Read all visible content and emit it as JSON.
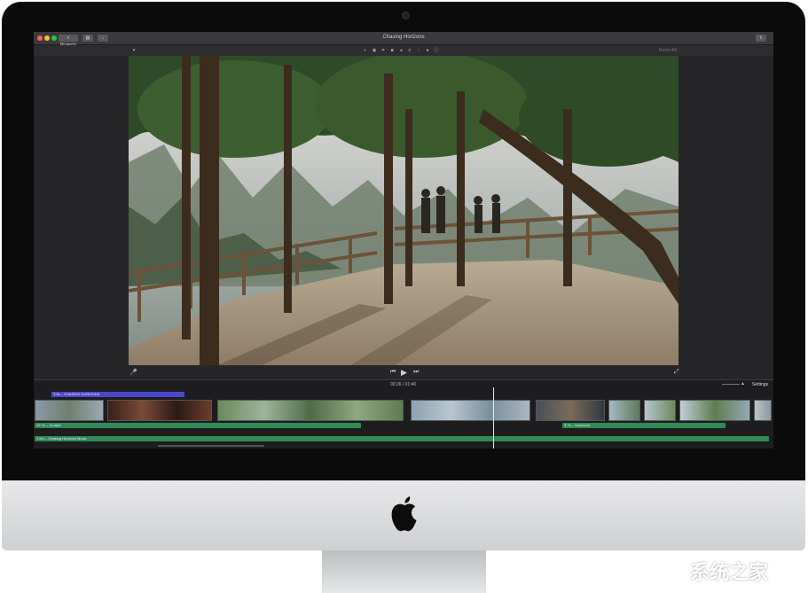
{
  "window": {
    "title": "Chasing Horizons",
    "projects_button": "< Projects",
    "share_icon": "share-icon"
  },
  "toolbar": {
    "tools": [
      "color-balance-icon",
      "color-correction-icon",
      "crop-icon",
      "camera-icon",
      "volume-icon",
      "speed-icon",
      "noise-reduction-icon",
      "clip-filter-icon",
      "info-icon"
    ],
    "reset_all": "Reset All"
  },
  "playback": {
    "timecode": "00:26 / 01:40",
    "settings": "Settings"
  },
  "timeline": {
    "title_clip": "3.5s – CHASING HORIZONS",
    "audio_clips": [
      {
        "label": "12.7s – 13.mp4"
      },
      {
        "label": "3.7s – Voiceover"
      }
    ],
    "music_label": "1.6m – Chasing Horizons Music"
  },
  "device": {
    "logo_icon": "apple-logo-icon"
  },
  "watermark": "系统之家"
}
